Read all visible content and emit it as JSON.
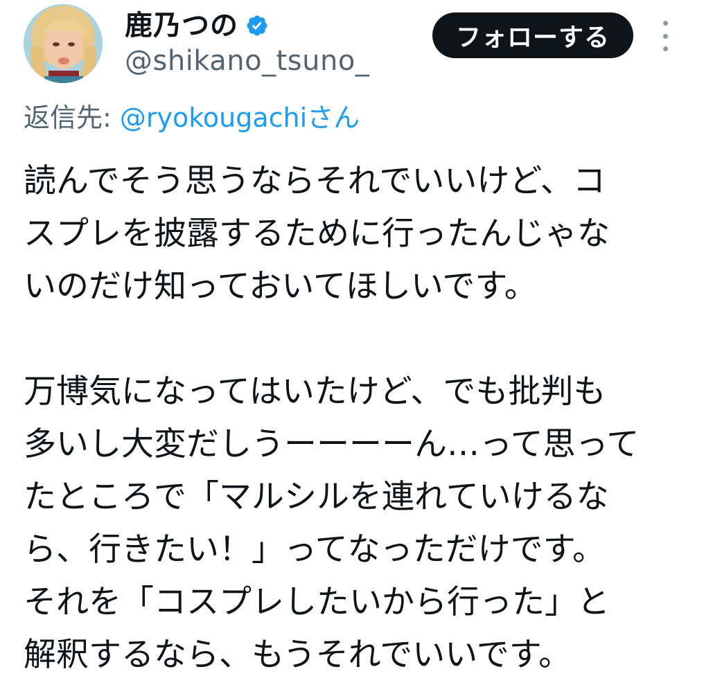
{
  "author": {
    "display_name": "鹿乃つの",
    "handle": "@shikano_tsuno_",
    "verified": true
  },
  "follow_button_label": "フォローする",
  "reply": {
    "prefix": "返信先: ",
    "mention": "@ryokougachi",
    "suffix": "さん"
  },
  "tweet": {
    "paragraph_1": [
      "読んでそう思うならそれでいいけど、コ",
      "スプレを披露するために行ったんじゃな",
      "いのだけ知っておいてほしいです。"
    ],
    "paragraph_2": [
      "万博気になってはいたけど、でも批判も",
      "多いし大変だしうーーーーん…って思って",
      "たところで「マルシルを連れていけるな",
      "ら、行きたい！」ってなっただけです。",
      "それを「コスプレしたいから行った」と",
      "解釈するなら、もうそれでいいです。"
    ]
  },
  "colors": {
    "text": "#0f1419",
    "secondary_text": "#536471",
    "link": "#1d9bf0",
    "follow_button_bg": "#0f1419",
    "follow_button_text": "#ffffff",
    "verified_badge": "#1d9bf0"
  },
  "icons": {
    "verified": "verified-badge-icon",
    "more": "more-options-icon"
  }
}
